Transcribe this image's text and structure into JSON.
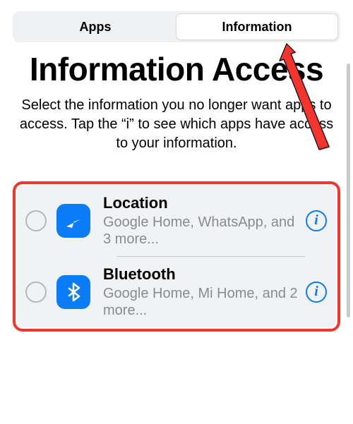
{
  "tabs": {
    "apps": "Apps",
    "info": "Information",
    "active": "info"
  },
  "title": "Information Access",
  "subtitle": "Select the information you no longer want apps to access. Tap the “i” to see which apps have access to your information.",
  "items": [
    {
      "title": "Location",
      "subtitle": "Google Home, WhatsApp, and 3 more...",
      "icon": "location-icon"
    },
    {
      "title": "Bluetooth",
      "subtitle": "Google Home, Mi Home, and 2 more...",
      "icon": "bluetooth-icon"
    }
  ],
  "colors": {
    "accent": "#0a7cf7",
    "highlight_border": "#f4352d",
    "muted": "#8a8b8e"
  }
}
